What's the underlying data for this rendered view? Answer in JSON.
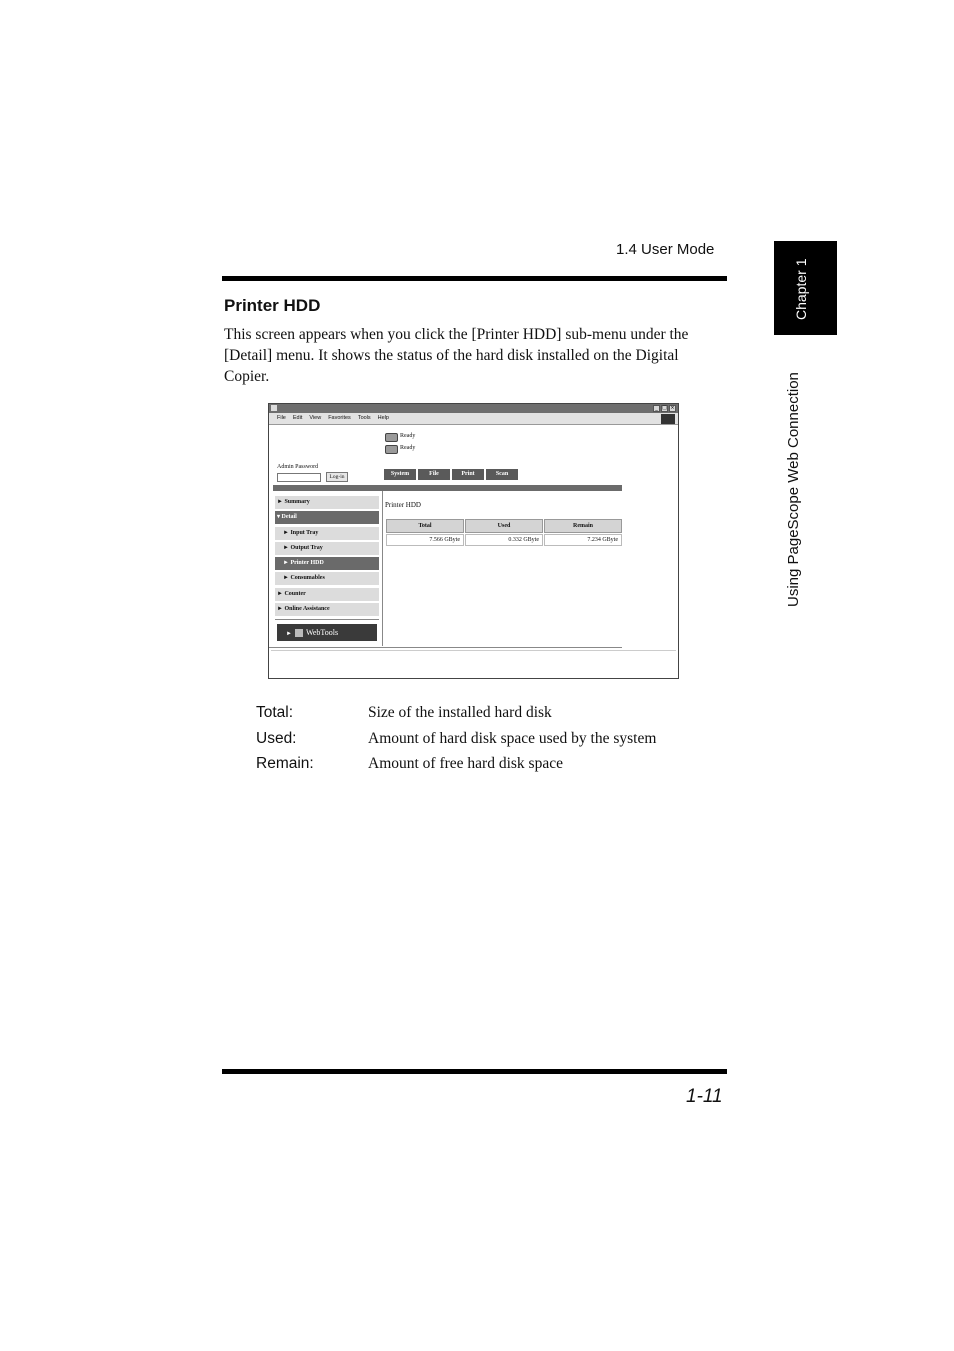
{
  "page": {
    "section_header": "1.4  User Mode",
    "chapter_tab": "Chapter 1",
    "side_title": "Using PageScope Web Connection",
    "page_number": "1-11"
  },
  "content": {
    "heading": "Printer HDD",
    "intro": "This screen appears when you click the [Printer HDD] sub-menu under the [Detail] menu. It shows the status of the hard disk installed on the Digital Copier."
  },
  "screenshot": {
    "menu": [
      "File",
      "Edit",
      "View",
      "Favorites",
      "Tools",
      "Help"
    ],
    "status": [
      "Ready",
      "Ready"
    ],
    "admin_label": "Admin Password",
    "login_label": "Log-in",
    "tabs": [
      "System",
      "File",
      "Print",
      "Scan"
    ],
    "nav": [
      {
        "label": "► Summary"
      },
      {
        "label": "▾ Detail"
      },
      {
        "label": "► Input Tray"
      },
      {
        "label": "► Output Tray"
      },
      {
        "label": "► Printer HDD"
      },
      {
        "label": "► Consumables"
      },
      {
        "label": "► Counter"
      },
      {
        "label": "► Online Assistance"
      }
    ],
    "webtools_label": "WebTools",
    "main_title": "Printer HDD",
    "table": {
      "headers": [
        "Total",
        "Used",
        "Remain"
      ],
      "values": [
        "7.566 GByte",
        "0.332 GByte",
        "7.234 GByte"
      ]
    }
  },
  "definitions": [
    {
      "term": "Total:",
      "desc": "Size of the installed hard disk"
    },
    {
      "term": "Used:",
      "desc": "Amount of hard disk space used by the system"
    },
    {
      "term": "Remain:",
      "desc": "Amount of free hard disk space"
    }
  ]
}
